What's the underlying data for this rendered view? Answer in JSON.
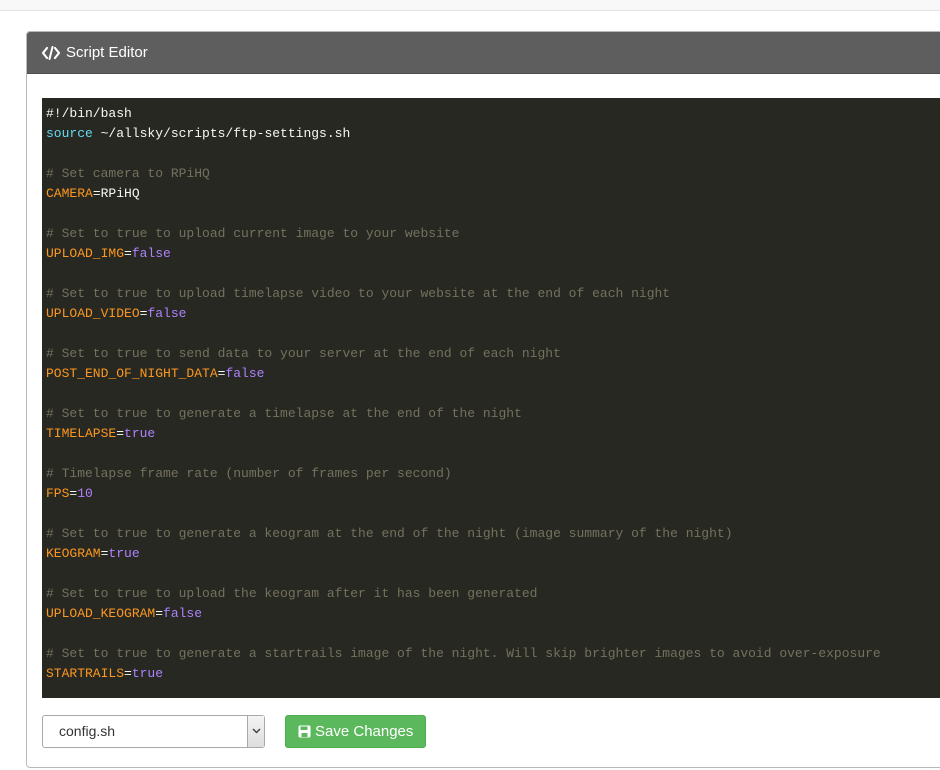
{
  "panel": {
    "title": "Script Editor",
    "icon": "code-icon"
  },
  "editor": {
    "lines": [
      [
        {
          "t": "plain",
          "v": "#!/bin/bash"
        }
      ],
      [
        {
          "t": "cmd",
          "v": "source"
        },
        {
          "t": "plain",
          "v": " ~/allsky/scripts/ftp-settings.sh"
        }
      ],
      [],
      [
        {
          "t": "comment",
          "v": "# Set camera to RPiHQ"
        }
      ],
      [
        {
          "t": "var",
          "v": "CAMERA"
        },
        {
          "t": "op",
          "v": "="
        },
        {
          "t": "plain",
          "v": "RPiHQ"
        }
      ],
      [],
      [
        {
          "t": "comment",
          "v": "# Set to true to upload current image to your website"
        }
      ],
      [
        {
          "t": "var",
          "v": "UPLOAD_IMG"
        },
        {
          "t": "op",
          "v": "="
        },
        {
          "t": "val-bool",
          "v": "false"
        }
      ],
      [],
      [
        {
          "t": "comment",
          "v": "# Set to true to upload timelapse video to your website at the end of each night"
        }
      ],
      [
        {
          "t": "var",
          "v": "UPLOAD_VIDEO"
        },
        {
          "t": "op",
          "v": "="
        },
        {
          "t": "val-bool",
          "v": "false"
        }
      ],
      [],
      [
        {
          "t": "comment",
          "v": "# Set to true to send data to your server at the end of each night"
        }
      ],
      [
        {
          "t": "var",
          "v": "POST_END_OF_NIGHT_DATA"
        },
        {
          "t": "op",
          "v": "="
        },
        {
          "t": "val-bool",
          "v": "false"
        }
      ],
      [],
      [
        {
          "t": "comment",
          "v": "# Set to true to generate a timelapse at the end of the night"
        }
      ],
      [
        {
          "t": "var",
          "v": "TIMELAPSE"
        },
        {
          "t": "op",
          "v": "="
        },
        {
          "t": "val-bool",
          "v": "true"
        }
      ],
      [],
      [
        {
          "t": "comment",
          "v": "# Timelapse frame rate (number of frames per second)"
        }
      ],
      [
        {
          "t": "var",
          "v": "FPS"
        },
        {
          "t": "op",
          "v": "="
        },
        {
          "t": "val-num",
          "v": "10"
        }
      ],
      [],
      [
        {
          "t": "comment",
          "v": "# Set to true to generate a keogram at the end of the night (image summary of the night)"
        }
      ],
      [
        {
          "t": "var",
          "v": "KEOGRAM"
        },
        {
          "t": "op",
          "v": "="
        },
        {
          "t": "val-bool",
          "v": "true"
        }
      ],
      [],
      [
        {
          "t": "comment",
          "v": "# Set to true to upload the keogram after it has been generated"
        }
      ],
      [
        {
          "t": "var",
          "v": "UPLOAD_KEOGRAM"
        },
        {
          "t": "op",
          "v": "="
        },
        {
          "t": "val-bool",
          "v": "false"
        }
      ],
      [],
      [
        {
          "t": "comment",
          "v": "# Set to true to generate a startrails image of the night. Will skip brighter images to avoid over-exposure"
        }
      ],
      [
        {
          "t": "var",
          "v": "STARTRAILS"
        },
        {
          "t": "op",
          "v": "="
        },
        {
          "t": "val-bool",
          "v": "true"
        }
      ]
    ]
  },
  "file_select": {
    "selected": "config.sh"
  },
  "save_button": {
    "label": "Save Changes",
    "icon": "floppy-disk-icon"
  }
}
